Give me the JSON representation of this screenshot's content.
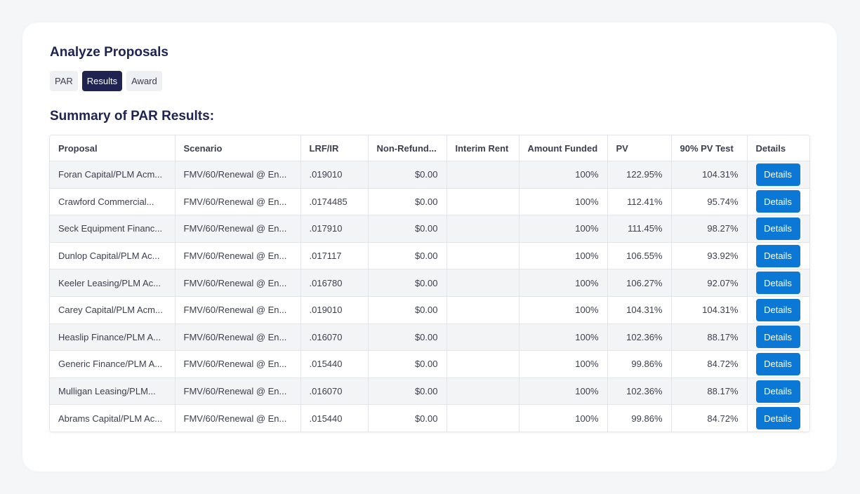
{
  "page": {
    "title": "Analyze Proposals",
    "subtitle": "Summary of PAR Results:"
  },
  "tabs": [
    {
      "label": "PAR",
      "active": false
    },
    {
      "label": "Results",
      "active": true
    },
    {
      "label": "Award",
      "active": false
    }
  ],
  "table": {
    "headers": [
      "Proposal",
      "Scenario",
      "LRF/IR",
      "Non-Refund...",
      "Interim Rent",
      "Amount Funded",
      "PV",
      "90% PV Test",
      "Details"
    ],
    "rows": [
      {
        "proposal": "Foran Capital/PLM Acm...",
        "scenario": "FMV/60/Renewal @ En...",
        "lrf": ".019010",
        "nonrefund": "$0.00",
        "interim": "",
        "funded": "100%",
        "pv": "122.95%",
        "pvtest": "104.31%",
        "details": "Details"
      },
      {
        "proposal": "Crawford Commercial...",
        "scenario": "FMV/60/Renewal @ En...",
        "lrf": ".0174485",
        "nonrefund": "$0.00",
        "interim": "",
        "funded": "100%",
        "pv": "112.41%",
        "pvtest": "95.74%",
        "details": "Details"
      },
      {
        "proposal": "Seck Equipment Financ...",
        "scenario": "FMV/60/Renewal @ En...",
        "lrf": ".017910",
        "nonrefund": "$0.00",
        "interim": "",
        "funded": "100%",
        "pv": "111.45%",
        "pvtest": "98.27%",
        "details": "Details"
      },
      {
        "proposal": "Dunlop Capital/PLM Ac...",
        "scenario": "FMV/60/Renewal @ En...",
        "lrf": ".017117",
        "nonrefund": "$0.00",
        "interim": "",
        "funded": "100%",
        "pv": "106.55%",
        "pvtest": "93.92%",
        "details": "Details"
      },
      {
        "proposal": "Keeler Leasing/PLM Ac...",
        "scenario": "FMV/60/Renewal @ En...",
        "lrf": ".016780",
        "nonrefund": "$0.00",
        "interim": "",
        "funded": "100%",
        "pv": "106.27%",
        "pvtest": "92.07%",
        "details": "Details"
      },
      {
        "proposal": "Carey Capital/PLM Acm...",
        "scenario": "FMV/60/Renewal @ En...",
        "lrf": ".019010",
        "nonrefund": "$0.00",
        "interim": "",
        "funded": "100%",
        "pv": "104.31%",
        "pvtest": "104.31%",
        "details": "Details"
      },
      {
        "proposal": "Heaslip Finance/PLM A...",
        "scenario": "FMV/60/Renewal @ En...",
        "lrf": ".016070",
        "nonrefund": "$0.00",
        "interim": "",
        "funded": "100%",
        "pv": "102.36%",
        "pvtest": "88.17%",
        "details": "Details"
      },
      {
        "proposal": "Generic Finance/PLM A...",
        "scenario": "FMV/60/Renewal @ En...",
        "lrf": ".015440",
        "nonrefund": "$0.00",
        "interim": "",
        "funded": "100%",
        "pv": "99.86%",
        "pvtest": "84.72%",
        "details": "Details"
      },
      {
        "proposal": "Mulligan Leasing/PLM...",
        "scenario": "FMV/60/Renewal @ En...",
        "lrf": ".016070",
        "nonrefund": "$0.00",
        "interim": "",
        "funded": "100%",
        "pv": "102.36%",
        "pvtest": "88.17%",
        "details": "Details"
      },
      {
        "proposal": "Abrams Capital/PLM Ac...",
        "scenario": "FMV/60/Renewal @ En...",
        "lrf": ".015440",
        "nonrefund": "$0.00",
        "interim": "",
        "funded": "100%",
        "pv": "99.86%",
        "pvtest": "84.72%",
        "details": "Details"
      }
    ]
  },
  "colors": {
    "primary_dark": "#1e2352",
    "button_blue": "#0a78d4",
    "row_stripe": "#f3f4f6"
  }
}
